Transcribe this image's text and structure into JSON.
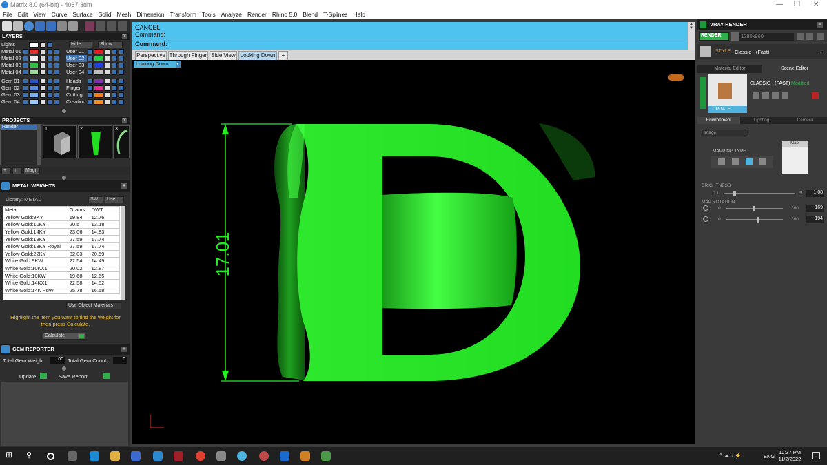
{
  "window": {
    "title": "Matrix 8.0 (64-bit) - 4067.3dm",
    "controls": [
      "minimize-icon",
      "maximize-icon",
      "close-icon"
    ]
  },
  "menu": [
    "File",
    "Edit",
    "View",
    "Curve",
    "Surface",
    "Solid",
    "Mesh",
    "Dimension",
    "Transform",
    "Tools",
    "Analyze",
    "Render",
    "Rhino 5.0",
    "Blend",
    "T-Splines",
    "Help"
  ],
  "layers": {
    "title": "LAYERS",
    "lights_label": "Lights",
    "hide_label": "Hide",
    "show_label": "Show",
    "left_rows": [
      "Metal 01",
      "Metal 02",
      "Metal 03",
      "Metal 04",
      "Gem 01",
      "Gem 02",
      "Gem 03",
      "Gem 04"
    ],
    "left_colors": [
      "#e53030",
      "#f0f0f0",
      "#30c040",
      "#a0d8a0",
      "#3050c0",
      "#5a8ae0",
      "#7ab0f0",
      "#9ac8f8"
    ],
    "right_rows": [
      "User 01",
      "User 02",
      "User 03",
      "User 04",
      "Heads",
      "Finger",
      "Cutting",
      "Creation"
    ],
    "right_colors": [
      "#e02020",
      "#20d040",
      "#2040e0",
      "#c0c0c0",
      "#8030b0",
      "#e03090",
      "#f08020",
      "#f09020"
    ],
    "selected": "User 02"
  },
  "projects": {
    "title": "PROJECTS",
    "list_item": "Render",
    "thumb_numbers": [
      "1",
      "2",
      "3"
    ],
    "magn_label": "Magn"
  },
  "metal_weights": {
    "title": "METAL WEIGHTS",
    "library_label": "Library: METAL",
    "sw_label": "SW",
    "user_label": "User",
    "columns": [
      "Metal",
      "Grams",
      "DWT"
    ],
    "rows": [
      [
        "Yellow Gold:9KY",
        "19.84",
        "12.76"
      ],
      [
        "Yellow Gold:10KY",
        "20.5",
        "13.18"
      ],
      [
        "Yellow Gold:14KY",
        "23.06",
        "14.83"
      ],
      [
        "Yellow Gold:18KY",
        "27.59",
        "17.74"
      ],
      [
        "Yellow Gold:18KY Royal",
        "27.59",
        "17.74"
      ],
      [
        "Yellow Gold:22KY",
        "32.03",
        "20.59"
      ],
      [
        "White Gold:9KW",
        "22.54",
        "14.49"
      ],
      [
        "White Gold:10KX1",
        "20.02",
        "12.87"
      ],
      [
        "White Gold:10KW",
        "19.68",
        "12.65"
      ],
      [
        "White Gold:14KX1",
        "22.58",
        "14.52"
      ],
      [
        "White Gold:14K PdW",
        "25.78",
        "16.58"
      ]
    ],
    "use_object_materials": "Use Object Materials",
    "hint": "Highlight the item you want to find the weight for then press Calculate.",
    "calculate_label": "Calculate"
  },
  "gem_reporter": {
    "title": "GEM REPORTER",
    "total_weight_label": "Total Gem Weight",
    "total_weight_value": ".00",
    "total_count_label": "Total Gem Count",
    "total_count_value": "0",
    "update_label": "Update",
    "save_report_label": "Save Report"
  },
  "command": {
    "line1": "CANCEL",
    "line2": "Command:",
    "prompt": "Command:"
  },
  "viewport_tabs": [
    "Perspective",
    "Through Finger",
    "Side View",
    "Looking Down"
  ],
  "active_tab": "Looking Down",
  "viewport_label": "Looking Down",
  "dimension_value": "17.01",
  "model_letter": "D",
  "model_color": "#22ee22",
  "vray": {
    "title": "VRAY RENDER",
    "render_label": "RENDER",
    "resolution": "1280x960",
    "style_label": "STYLE",
    "style_value": "Classic - (Fast)",
    "tabs": [
      "Material Editor",
      "Scene Editor"
    ],
    "preset_name": "CLASSIC - (FAST)",
    "modified_label": "Modified",
    "update_label": "UPDATE",
    "env_tabs": [
      "Environment",
      "Lighting",
      "Camera"
    ],
    "env_type": "Image",
    "mapping_type_label": "MAPPING TYPE",
    "map_label": "Map",
    "brightness_label": "BRIGHTNESS",
    "brightness_min": "0.1",
    "brightness_max": "5",
    "brightness_value": "1.08",
    "map_rotation_label": "MAP ROTATION",
    "rot1_min": "0",
    "rot1_max": "360",
    "rot1_value": "169",
    "rot2_min": "0",
    "rot2_max": "360",
    "rot2_value": "194"
  },
  "taskbar": {
    "lang": "ENG",
    "time": "10:37 PM",
    "date": "11/2/2022"
  }
}
